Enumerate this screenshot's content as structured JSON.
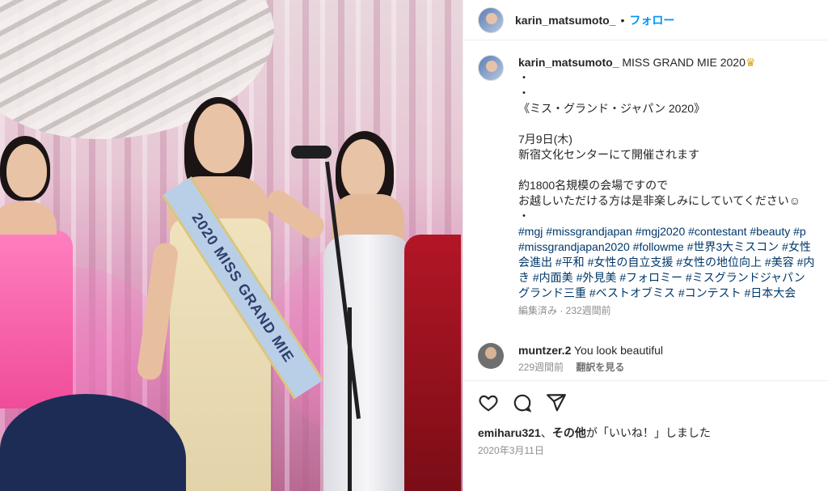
{
  "post": {
    "username": "karin_matsumoto_",
    "follow_label": "フォロー",
    "separator": "•"
  },
  "photo": {
    "sash_text": "2020 MISS GRAND MIE"
  },
  "caption": {
    "username": "karin_matsumoto_",
    "lines": [
      "MISS GRAND MIE 2020",
      "・",
      "・",
      "《ミス・グランド・ジャパン 2020》",
      "",
      "7月9日(木)",
      "新宿文化センターにて開催されます",
      "",
      "約1800名規模の会場ですので",
      "お越しいただける方は是非楽しみにしていてください☺︎",
      "・"
    ],
    "crown_icon": "crown-icon",
    "hashtag_lines": [
      "#mgj #missgrandjapan #mgj2020 #contestant #beauty #p",
      "#missgrandjapan2020 #followme #世界3大ミスコン #女性",
      "会進出 #平和 #女性の自立支援 #女性の地位向上 #美容 #内",
      "き #内面美 #外見美 #フォロミー #ミスグランドジャパン",
      "グランド三重 #ベストオブミス #コンテスト #日本大会"
    ],
    "meta": "編集済み · 232週間前"
  },
  "comment": {
    "username": "muntzer.2",
    "text": "You look beautiful",
    "time": "229週間前",
    "translate_label": "翻訳を見る"
  },
  "actions": {
    "icons": [
      "heart-icon",
      "comment-icon",
      "share-icon"
    ]
  },
  "likes": {
    "user": "emiharu321",
    "middle": "、",
    "others": "その他",
    "suffix": "が「いいね！」しました"
  },
  "date": "2020年3月11日",
  "colors": {
    "link_blue": "#0095f6",
    "hashtag": "#00376b",
    "muted": "#8e8e8e"
  }
}
